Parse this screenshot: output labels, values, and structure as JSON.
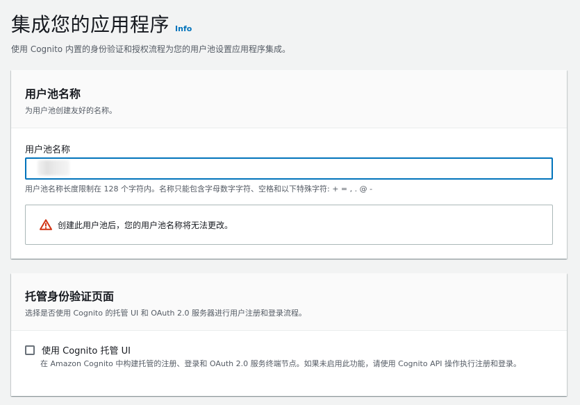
{
  "header": {
    "title": "集成您的应用程序",
    "info_link": "Info",
    "description": "使用 Cognito 内置的身份验证和授权流程为您的用户池设置应用程序集成。"
  },
  "user_pool_name_panel": {
    "title": "用户池名称",
    "subtitle": "为用户池创建友好的名称。",
    "field_label": "用户池名称",
    "input_value": "",
    "constraint_text": "用户池名称长度限制在 128 个字符内。名称只能包含字母数字字符、空格和以下特殊字符: + = , . @ -",
    "warning": {
      "icon": "warning-icon",
      "text": "创建此用户池后，您的用户池名称将无法更改。"
    }
  },
  "hosted_ui_panel": {
    "title": "托管身份验证页面",
    "subtitle": "选择是否使用 Cognito 的托管 UI 和 OAuth 2.0 服务器进行用户注册和登录流程。",
    "checkbox": {
      "label": "使用 Cognito 托管 UI",
      "checked": false,
      "description": "在 Amazon Cognito 中构建托管的注册、登录和 OAuth 2.0 服务终端节点。如果未启用此功能，请使用 Cognito API 操作执行注册和登录。"
    }
  },
  "colors": {
    "link": "#0073bb",
    "warning": "#d13212",
    "input_focus_border": "#0073bb",
    "background": "#f2f3f3"
  }
}
